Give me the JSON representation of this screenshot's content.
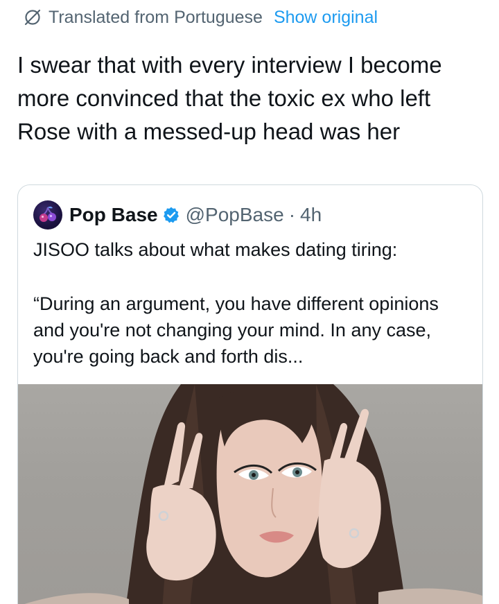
{
  "translation": {
    "label": "Translated from Portuguese",
    "show_original": "Show original"
  },
  "tweet": {
    "text": "I swear that with every interview I become more convinced that the toxic ex who left Rose with a messed-up head was her"
  },
  "quoted_tweet": {
    "display_name": "Pop Base",
    "handle": "@PopBase",
    "separator": "·",
    "age": "4h",
    "line1": "JISOO talks about what makes dating tiring:",
    "line2": "“During an argument, you have different opinions and you're not changing your mind. In any case, you're going back and forth dis...",
    "avatar_icon": "cherry-logo-icon",
    "verified_icon": "verified-badge-icon",
    "verified_color": "#1d9bf0",
    "media_description": "photo"
  },
  "colors": {
    "link": "#1d9bf0",
    "secondary_text": "#536471",
    "primary_text": "#0f1419",
    "border": "#cfd9de"
  }
}
